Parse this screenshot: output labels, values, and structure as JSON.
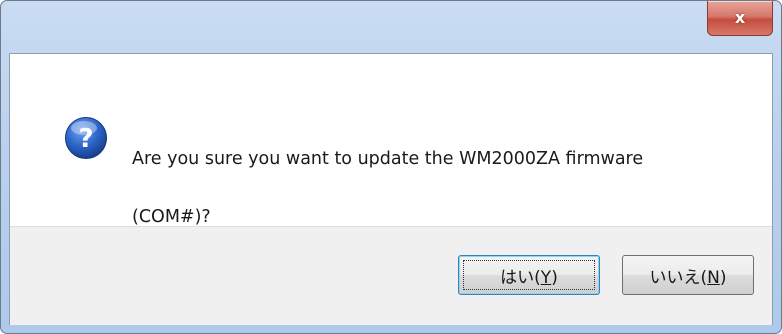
{
  "dialog": {
    "close_label": "x",
    "message_line1": "Are you sure you want to update the WM2000ZA firmware",
    "message_line2": "(COM#)?",
    "icon": "question-icon"
  },
  "buttons": {
    "yes": {
      "text": "はい(",
      "mnemonic": "Y",
      "suffix": ")"
    },
    "no": {
      "text": "いいえ(",
      "mnemonic": "N",
      "suffix": ")"
    }
  },
  "colors": {
    "icon_blue": "#2a63c8",
    "close_red": "#c54d3d",
    "frame_blue": "#b9d1ee"
  }
}
